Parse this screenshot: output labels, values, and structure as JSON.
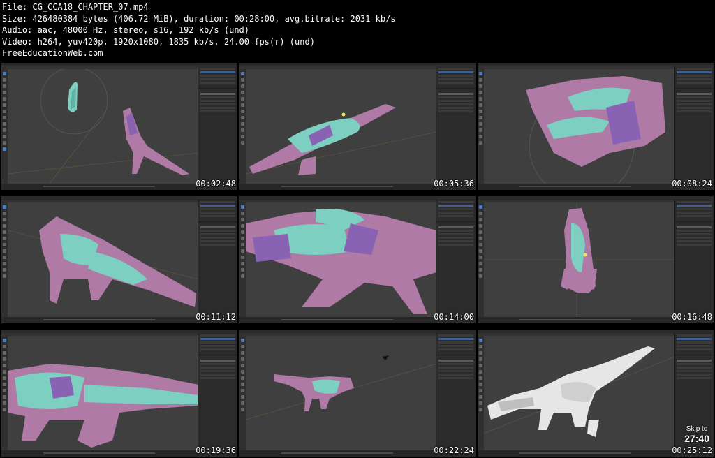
{
  "header": {
    "file": "File: CG_CCA18_CHAPTER_07.mp4",
    "size": "Size: 426480384 bytes (406.72 MiB), duration: 00:28:00, avg.bitrate: 2031 kb/s",
    "audio": "Audio: aac, 48000 Hz, stereo, s16, 192 kb/s (und)",
    "video": "Video: h264, yuv420p, 1920x1080, 1835 kb/s, 24.00 fps(r) (und)",
    "site": "FreeEducationWeb.com"
  },
  "thumbnails": [
    {
      "timestamp": "00:02:48"
    },
    {
      "timestamp": "00:05:36"
    },
    {
      "timestamp": "00:08:24"
    },
    {
      "timestamp": "00:11:12"
    },
    {
      "timestamp": "00:14:00"
    },
    {
      "timestamp": "00:16:48"
    },
    {
      "timestamp": "00:19:36"
    },
    {
      "timestamp": "00:22:24"
    },
    {
      "timestamp": "00:25:12"
    }
  ],
  "skip": {
    "label": "Skip to",
    "time": "27:40"
  },
  "colors": {
    "pink": "#b07aa6",
    "teal": "#7ccfc1",
    "purple": "#8a62b4",
    "viewport": "#3f3f3f",
    "panel": "#2b2b2b",
    "white_model": "#e6e6e6"
  }
}
